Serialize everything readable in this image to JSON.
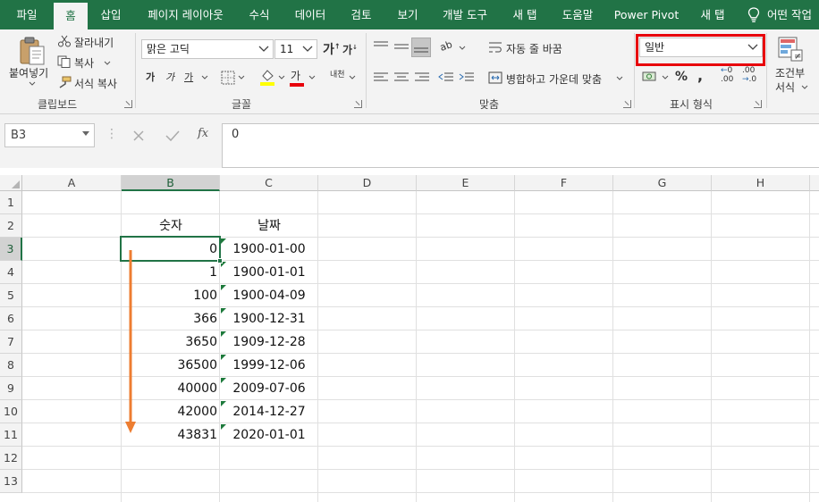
{
  "tabs": [
    "파일",
    "홈",
    "삽입",
    "페이지 레이아웃",
    "수식",
    "데이터",
    "검토",
    "보기",
    "개발 도구",
    "새 탭",
    "도움말",
    "Power Pivot",
    "새 탭",
    "어떤 작업"
  ],
  "ribbon": {
    "clipboard": {
      "paste": "붙여넣기",
      "cut": "잘라내기",
      "copy": "복사",
      "format_painter": "서식 복사",
      "label": "클립보드"
    },
    "font": {
      "name": "맑은 고딕",
      "size": "11",
      "label": "글꼴",
      "bold": "가",
      "italic": "가",
      "underline": "가",
      "font_color_glyph": "가",
      "phonetic": "내천"
    },
    "alignment": {
      "wrap": "자동 줄 바꿈",
      "merge": "병합하고 가운데 맞춤",
      "label": "맞춤"
    },
    "number": {
      "format": "일반",
      "percent": "%",
      "comma": ",",
      "label": "표시 형식"
    },
    "styles": {
      "conditional_line1": "조건부",
      "conditional_line2": "서식"
    }
  },
  "formula_bar": {
    "name_box": "B3",
    "fx": "fx",
    "value": "0"
  },
  "sheet": {
    "columns": [
      "A",
      "B",
      "C",
      "D",
      "E",
      "F",
      "G",
      "H"
    ],
    "rows": [
      "1",
      "2",
      "3",
      "4",
      "5",
      "6",
      "7",
      "8",
      "9",
      "10",
      "11",
      "12",
      "13"
    ],
    "headers": {
      "number": "숫자",
      "date": "날짜"
    },
    "data": [
      {
        "number": "0",
        "date": "1900-01-00"
      },
      {
        "number": "1",
        "date": "1900-01-01"
      },
      {
        "number": "100",
        "date": "1900-04-09"
      },
      {
        "number": "366",
        "date": "1900-12-31"
      },
      {
        "number": "3650",
        "date": "1909-12-28"
      },
      {
        "number": "36500",
        "date": "1999-12-06"
      },
      {
        "number": "40000",
        "date": "2009-07-06"
      },
      {
        "number": "42000",
        "date": "2014-12-27"
      },
      {
        "number": "43831",
        "date": "2020-01-01"
      }
    ],
    "selected_cell": "B3"
  },
  "colors": {
    "excel_green": "#217346",
    "highlight_red": "#e8000b",
    "arrow_orange": "#ed7d31"
  }
}
